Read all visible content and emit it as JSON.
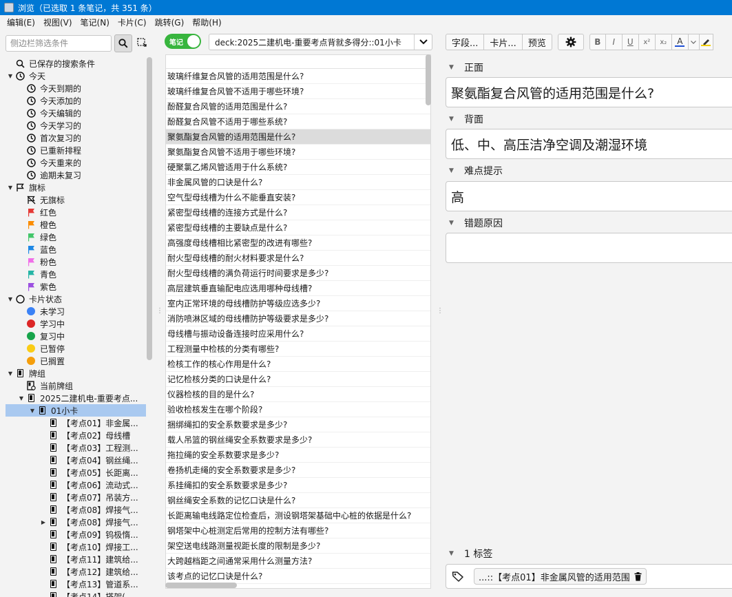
{
  "window": {
    "title": "浏览（已选取 1 条笔记，共 351 条）"
  },
  "menu": [
    "编辑(E)",
    "视图(V)",
    "笔记(N)",
    "卡片(C)",
    "跳转(G)",
    "帮助(H)"
  ],
  "sidebar": {
    "search_placeholder": "侧边栏筛选条件",
    "tree": [
      {
        "label": "已保存的搜索条件",
        "icon": "saved-search-icon",
        "level": 0,
        "arrow": ""
      },
      {
        "label": "今天",
        "icon": "clock-icon",
        "level": 0,
        "arrow": "down"
      },
      {
        "label": "今天到期的",
        "icon": "clock-icon",
        "level": 1,
        "arrow": ""
      },
      {
        "label": "今天添加的",
        "icon": "clock-icon",
        "level": 1,
        "arrow": ""
      },
      {
        "label": "今天编辑的",
        "icon": "clock-icon",
        "level": 1,
        "arrow": ""
      },
      {
        "label": "今天学习的",
        "icon": "clock-icon",
        "level": 1,
        "arrow": ""
      },
      {
        "label": "首次复习的",
        "icon": "clock-icon",
        "level": 1,
        "arrow": ""
      },
      {
        "label": "已重新排程",
        "icon": "clock-icon",
        "level": 1,
        "arrow": ""
      },
      {
        "label": "今天重来的",
        "icon": "clock-icon",
        "level": 1,
        "arrow": ""
      },
      {
        "label": "逾期未复习",
        "icon": "clock-icon",
        "level": 1,
        "arrow": ""
      },
      {
        "label": "旗标",
        "icon": "flag-outline-icon",
        "level": 0,
        "arrow": "down"
      },
      {
        "label": "无旗标",
        "icon": "no-flag-icon",
        "level": 1,
        "arrow": ""
      },
      {
        "label": "红色",
        "icon": "flag-icon",
        "color": "#e53935",
        "level": 1,
        "arrow": ""
      },
      {
        "label": "橙色",
        "icon": "flag-icon",
        "color": "#fb8c00",
        "level": 1,
        "arrow": ""
      },
      {
        "label": "绿色",
        "icon": "flag-icon",
        "color": "#43c66a",
        "level": 1,
        "arrow": ""
      },
      {
        "label": "蓝色",
        "icon": "flag-icon",
        "color": "#1e88e5",
        "level": 1,
        "arrow": ""
      },
      {
        "label": "粉色",
        "icon": "flag-icon",
        "color": "#f06ee8",
        "level": 1,
        "arrow": ""
      },
      {
        "label": "青色",
        "icon": "flag-icon",
        "color": "#26b5a6",
        "level": 1,
        "arrow": ""
      },
      {
        "label": "紫色",
        "icon": "flag-icon",
        "color": "#9c4fe0",
        "level": 1,
        "arrow": ""
      },
      {
        "label": "卡片状态",
        "icon": "circle-outline-icon",
        "level": 0,
        "arrow": "down"
      },
      {
        "label": "未学习",
        "icon": "dot-icon",
        "color": "#3b82f6",
        "level": 1,
        "arrow": ""
      },
      {
        "label": "学习中",
        "icon": "dot-icon",
        "color": "#dc2626",
        "level": 1,
        "arrow": ""
      },
      {
        "label": "复习中",
        "icon": "dot-icon",
        "color": "#16a34a",
        "level": 1,
        "arrow": ""
      },
      {
        "label": "已暂停",
        "icon": "dot-icon",
        "color": "#facc15",
        "level": 1,
        "arrow": ""
      },
      {
        "label": "已搁置",
        "icon": "dot-icon",
        "color": "#f59e0b",
        "level": 1,
        "arrow": ""
      },
      {
        "label": "牌组",
        "icon": "deck-icon",
        "level": 0,
        "arrow": "down"
      },
      {
        "label": "当前牌组",
        "icon": "current-deck-icon",
        "level": 1,
        "arrow": ""
      },
      {
        "label": "2025二建机电-重要考点...",
        "icon": "deck-icon",
        "level": 1,
        "arrow": "down"
      },
      {
        "label": "01小卡",
        "icon": "deck-icon",
        "level": 2,
        "arrow": "down",
        "selected": true
      },
      {
        "label": "【考点01】非金属...",
        "icon": "deck-icon",
        "level": 3,
        "arrow": ""
      },
      {
        "label": "【考点02】母线槽",
        "icon": "deck-icon",
        "level": 3,
        "arrow": ""
      },
      {
        "label": "【考点03】工程测...",
        "icon": "deck-icon",
        "level": 3,
        "arrow": ""
      },
      {
        "label": "【考点04】钢丝绳...",
        "icon": "deck-icon",
        "level": 3,
        "arrow": ""
      },
      {
        "label": "【考点05】长距离...",
        "icon": "deck-icon",
        "level": 3,
        "arrow": ""
      },
      {
        "label": "【考点06】流动式...",
        "icon": "deck-icon",
        "level": 3,
        "arrow": ""
      },
      {
        "label": "【考点07】吊装方...",
        "icon": "deck-icon",
        "level": 3,
        "arrow": ""
      },
      {
        "label": "【考点08】焊接气...",
        "icon": "deck-icon",
        "level": 3,
        "arrow": ""
      },
      {
        "label": "【考点08】焊接气...",
        "icon": "deck-icon",
        "level": 3,
        "arrow": "right"
      },
      {
        "label": "【考点09】钨极惰...",
        "icon": "deck-icon",
        "level": 3,
        "arrow": ""
      },
      {
        "label": "【考点10】焊接工...",
        "icon": "deck-icon",
        "level": 3,
        "arrow": ""
      },
      {
        "label": "【考点11】建筑给...",
        "icon": "deck-icon",
        "level": 3,
        "arrow": ""
      },
      {
        "label": "【考点12】建筑给...",
        "icon": "deck-icon",
        "level": 3,
        "arrow": ""
      },
      {
        "label": "【考点13】管道系...",
        "icon": "deck-icon",
        "level": 3,
        "arrow": ""
      },
      {
        "label": "【考点14】搭架(...",
        "icon": "deck-icon",
        "level": 3,
        "arrow": ""
      }
    ]
  },
  "list": {
    "mode_label": "笔记",
    "search_query": "deck:2025二建机电-重要考点背就多得分::01小卡",
    "selected_index": 4,
    "rows": [
      "玻璃纤维复合风管的适用范围是什么?",
      "玻璃纤维复合风管不适用于哪些环境?",
      "酚醛复合风管的适用范围是什么?",
      "酚醛复合风管不适用于哪些系统?",
      "聚氨酯复合风管的适用范围是什么?",
      "聚氨酯复合风管不适用于哪些环境?",
      "硬聚氯乙烯风管适用于什么系统?",
      "非金属风管的口诀是什么?",
      "空气型母线槽为什么不能垂直安装?",
      "紧密型母线槽的连接方式是什么?",
      "紧密型母线槽的主要缺点是什么?",
      "高强度母线槽相比紧密型的改进有哪些?",
      "耐火型母线槽的耐火材料要求是什么?",
      "耐火型母线槽的满负荷运行时间要求是多少?",
      "高层建筑垂直输配电应选用哪种母线槽?",
      "室内正常环境的母线槽防护等级应选多少?",
      "消防喷淋区域的母线槽防护等级要求是多少?",
      "母线槽与振动设备连接时应采用什么?",
      "工程测量中检核的分类有哪些?",
      "检核工作的核心作用是什么?",
      "记忆检核分类的口诀是什么?",
      "仪器检核的目的是什么?",
      "验收检核发生在哪个阶段?",
      "捆绑绳扣的安全系数要求是多少?",
      "载人吊篮的钢丝绳安全系数要求是多少?",
      "拖拉绳的安全系数要求是多少?",
      "卷扬机走绳的安全系数要求是多少?",
      "系挂绳扣的安全系数要求是多少?",
      "钢丝绳安全系数的记忆口诀是什么?",
      "长距离输电线路定位检查后，测设钢塔架基础中心桩的依据是什么?",
      "钢塔架中心桩测定后常用的控制方法有哪些?",
      "架空送电线路测量视距长度的限制是多少?",
      "大跨越档距之间通常采用什么测量方法?",
      "该考点的记忆口诀是什么?"
    ]
  },
  "editor": {
    "toolbar": {
      "fields_btn": "字段...",
      "cards_btn": "卡片...",
      "preview_btn": "预览"
    },
    "format": {
      "bold": "B",
      "italic": "I",
      "underline": "U",
      "superscript": "x²",
      "subscript": "x₂",
      "text_color": "A",
      "text_color_value": "#1e4fd6",
      "highlight_color_value": "#f5d000"
    },
    "fields": [
      {
        "name": "正面",
        "value": "聚氨酯复合风管的适用范围是什么?"
      },
      {
        "name": "背面",
        "value": "低、中、高压洁净空调及潮湿环境"
      },
      {
        "name": "难点提示",
        "value": "高"
      },
      {
        "name": "错题原因",
        "value": ""
      }
    ],
    "tags": {
      "header": "1 标签",
      "chip": "...::【考点01】非金属风管的适用范围"
    }
  }
}
